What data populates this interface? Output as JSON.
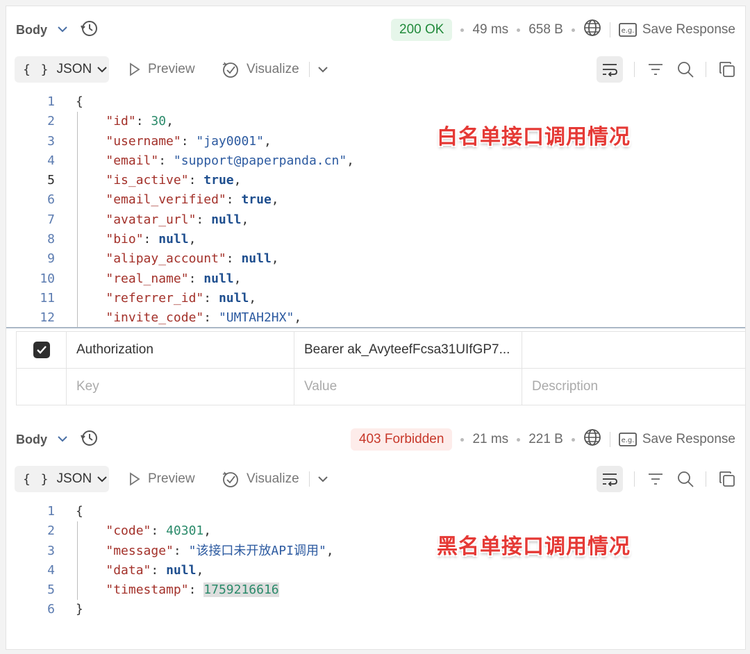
{
  "panel1": {
    "tab_body": "Body",
    "status": "200 OK",
    "time": "49 ms",
    "size": "658 B",
    "save_response": "Save Response",
    "toolbar": {
      "format": "JSON",
      "format_braces": "{ }",
      "preview": "Preview",
      "visualize": "Visualize"
    },
    "overlay_label": "白名单接口调用情况",
    "lines": [
      {
        "n": "1",
        "text": "{"
      },
      {
        "n": "2",
        "key": "\"id\"",
        "value": "30",
        "vtype": "n"
      },
      {
        "n": "3",
        "key": "\"username\"",
        "value": "\"jay0001\"",
        "vtype": "s"
      },
      {
        "n": "4",
        "key": "\"email\"",
        "value": "\"support@paperpanda.cn\"",
        "vtype": "s"
      },
      {
        "n": "5",
        "key": "\"is_active\"",
        "value": "true",
        "vtype": "kw"
      },
      {
        "n": "6",
        "key": "\"email_verified\"",
        "value": "true",
        "vtype": "kw"
      },
      {
        "n": "7",
        "key": "\"avatar_url\"",
        "value": "null",
        "vtype": "kw"
      },
      {
        "n": "8",
        "key": "\"bio\"",
        "value": "null",
        "vtype": "kw"
      },
      {
        "n": "9",
        "key": "\"alipay_account\"",
        "value": "null",
        "vtype": "kw"
      },
      {
        "n": "10",
        "key": "\"real_name\"",
        "value": "null",
        "vtype": "kw"
      },
      {
        "n": "11",
        "key": "\"referrer_id\"",
        "value": "null",
        "vtype": "kw"
      },
      {
        "n": "12",
        "key": "\"invite_code\"",
        "value": "\"UMTAH2HX\"",
        "vtype": "s"
      }
    ]
  },
  "headers_table": {
    "row1": {
      "key": "Authorization",
      "value": "Bearer ak_AvyteefFcsa31UIfGP7...",
      "description": ""
    },
    "placeholders": {
      "key": "Key",
      "value": "Value",
      "description": "Description"
    }
  },
  "panel2": {
    "tab_body": "Body",
    "status": "403 Forbidden",
    "time": "21 ms",
    "size": "221 B",
    "save_response": "Save Response",
    "toolbar": {
      "format": "JSON",
      "format_braces": "{ }",
      "preview": "Preview",
      "visualize": "Visualize"
    },
    "overlay_label": "黑名单接口调用情况",
    "lines": [
      {
        "n": "1",
        "text": "{"
      },
      {
        "n": "2",
        "key": "\"code\"",
        "value": "40301",
        "vtype": "n"
      },
      {
        "n": "3",
        "key": "\"message\"",
        "value": "\"该接口未开放API调用\"",
        "vtype": "s"
      },
      {
        "n": "4",
        "key": "\"data\"",
        "value": "null",
        "vtype": "kw"
      },
      {
        "n": "5",
        "key": "\"timestamp\"",
        "value": "1759216616",
        "vtype": "n",
        "highlight": true,
        "last": true
      },
      {
        "n": "6",
        "text": "}"
      }
    ]
  },
  "colors": {
    "ok_green": "#218a3b",
    "error_red": "#c7382a",
    "json_key": "#a3312a",
    "json_string": "#2c5aa0",
    "json_number": "#2a8a6a",
    "overlay_red": "#e53935"
  }
}
